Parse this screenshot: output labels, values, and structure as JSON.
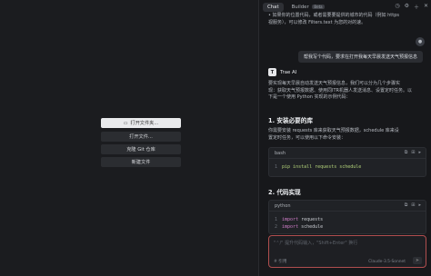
{
  "editor": {
    "buttons": [
      {
        "label": "打开文件夹...",
        "icon": "folder-icon"
      },
      {
        "label": "打开文件..."
      },
      {
        "label": "克隆 Git 仓库"
      },
      {
        "label": "新建文件"
      }
    ]
  },
  "panel": {
    "tabs": [
      {
        "label": "Chat"
      },
      {
        "label": "Builder",
        "badge": "Beta"
      }
    ],
    "top_text_lines": [
      "• 如果你的位置代码，或者需要要提供的城市的代码（例如 https",
      "  视服务），可以修改 Filters.text 为您的对的速。"
    ],
    "user_message": "帮我写个代码，要求在打开我每天早晨发送天气预报信息",
    "ai_name": "Trae AI",
    "ai_intro": [
      "要实现每天早晨自动发送天气预报信息，我们可以分为几个步骤实",
      "现：获取天气预报数据、使用同ITR机器人发送消息、设置定时任务。以",
      "下是一个使用 Python 实现的示例代码："
    ],
    "section1": "1. 安装必要的库",
    "section1_text": [
      "你需要安装 requests 库来获取天气预报数据，schedule 库来设",
      "置定时任务，可以使用以下命令安装："
    ],
    "code1": {
      "lang": "bash",
      "line_no": "1",
      "code": "pip install requests schedule"
    },
    "section2": "2. 代码实现",
    "code2": {
      "lang": "python",
      "lines": [
        {
          "n": "1",
          "kw": "import",
          "mod": "requests"
        },
        {
          "n": "2",
          "kw": "import",
          "mod": "schedule"
        }
      ]
    },
    "input": {
      "placeholder": "\"⌃/\" 提升代码输入，\"Shift+Enter\" 换行",
      "at_label": "# 引用",
      "model": "Claude-3.5-Sonnet"
    }
  }
}
